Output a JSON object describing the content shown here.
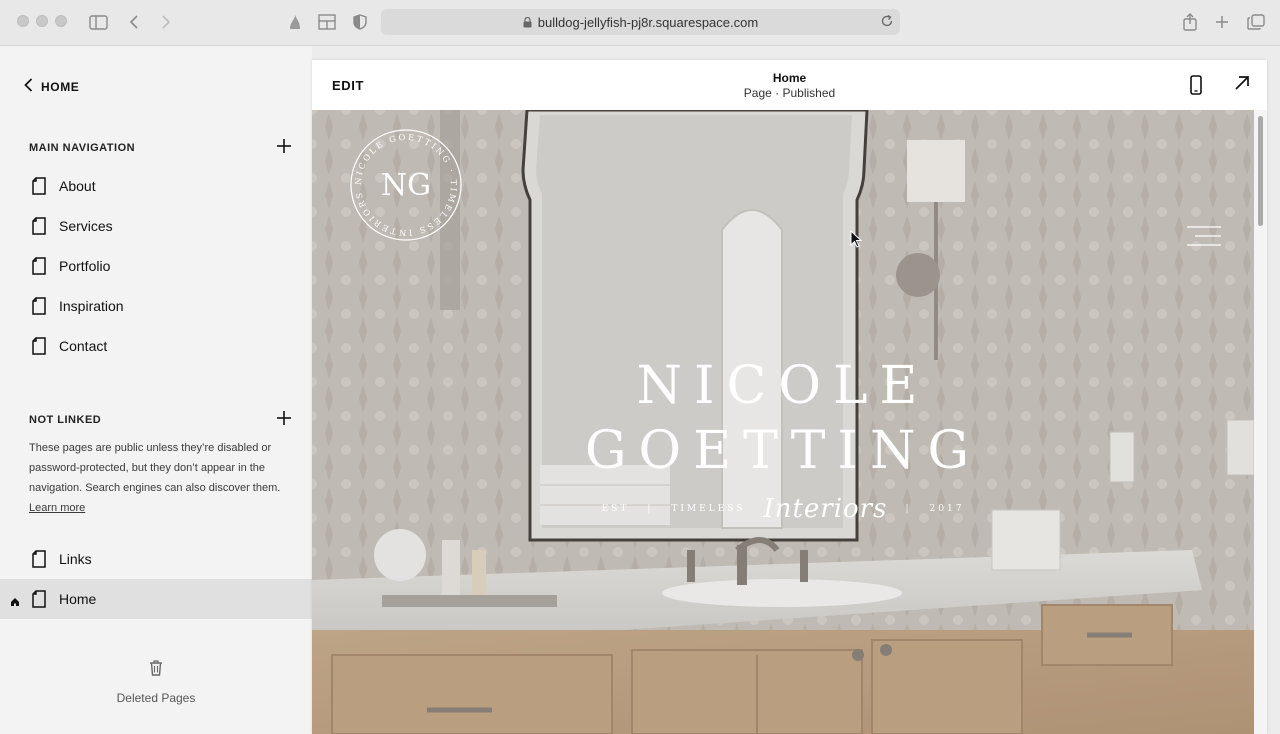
{
  "browser": {
    "url": "bulldog-jellyfish-pj8r.squarespace.com"
  },
  "sidebar": {
    "back_label": "HOME",
    "main_navigation": {
      "title": "MAIN NAVIGATION",
      "items": [
        {
          "label": "About"
        },
        {
          "label": "Services"
        },
        {
          "label": "Portfolio"
        },
        {
          "label": "Inspiration"
        },
        {
          "label": "Contact"
        }
      ]
    },
    "not_linked": {
      "title": "NOT LINKED",
      "description": "These pages are public unless they’re disabled or password-protected, but they don’t appear in the navigation. Search engines can also discover them.",
      "learn_more": "Learn more",
      "items": [
        {
          "label": "Links"
        },
        {
          "label": "Home",
          "active": true
        }
      ]
    },
    "deleted_pages_label": "Deleted Pages"
  },
  "editor": {
    "edit_label": "EDIT",
    "page_title": "Home",
    "page_status": "Page · Published"
  },
  "hero": {
    "line1": "NICOLE",
    "line2": "GOETTING",
    "tag_est": "EST",
    "tag_timeless": "TIMELESS",
    "tag_script": "Interiors",
    "tag_year": "2017",
    "logo_ring_text": "NICOLE GOETTING · TIMELESS INTERIORS",
    "logo_monogram": "NG"
  },
  "colors": {
    "sidebar_bg": "#f3f3f3",
    "active_row": "#e0e0e0",
    "chrome_bg": "#e8e8e8"
  }
}
